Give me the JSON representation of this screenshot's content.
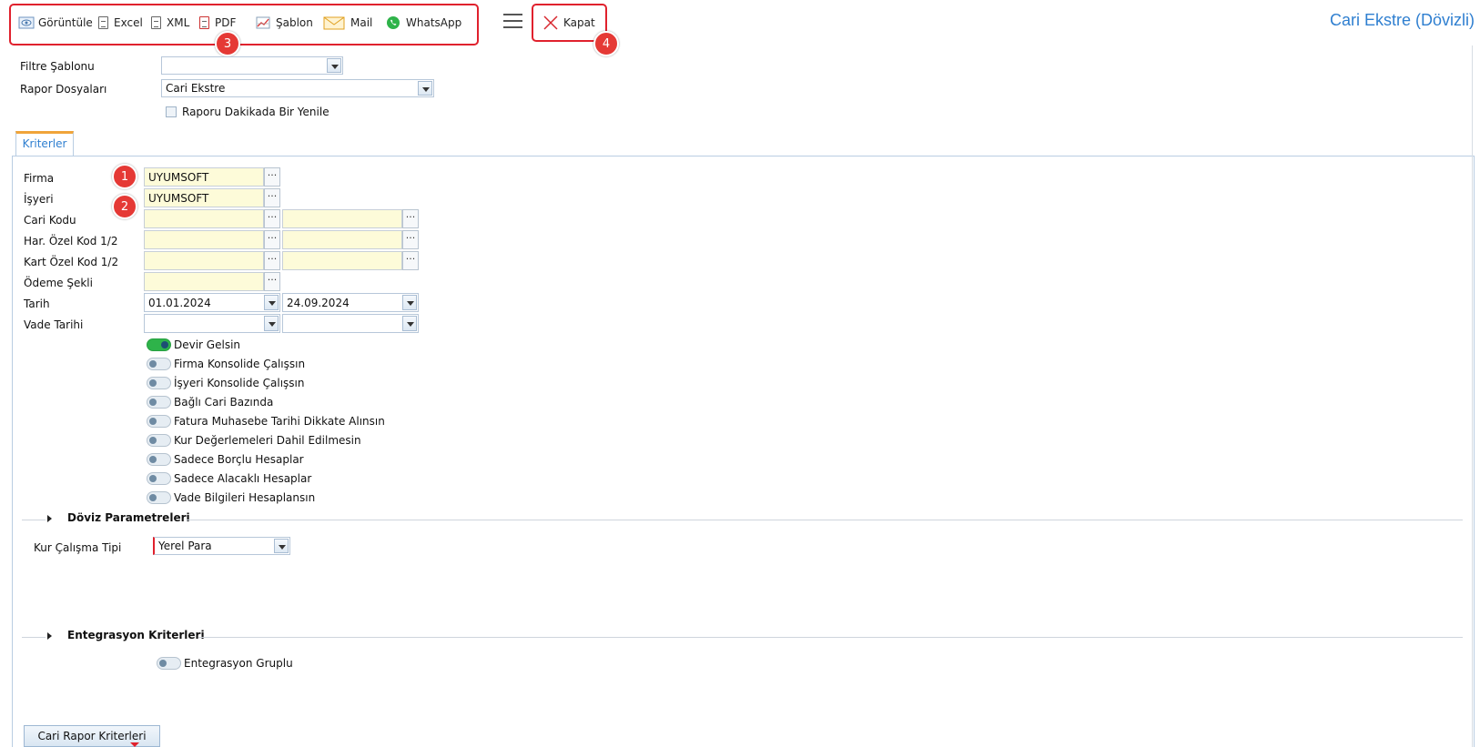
{
  "toolbar": {
    "goruntule": "Görüntüle",
    "excel": "Excel",
    "xml": "XML",
    "pdf": "PDF",
    "sablon": "Şablon",
    "mail": "Mail",
    "whatsapp": "WhatsApp",
    "kapat": "Kapat"
  },
  "page_title": "Cari Ekstre (Dövizli)",
  "badges": {
    "b1": "1",
    "b2": "2",
    "b3": "3",
    "b4": "4"
  },
  "filter": {
    "sablon_label": "Filtre Şablonu",
    "sablon_value": "",
    "rapor_label": "Rapor Dosyaları",
    "rapor_value": "Cari Ekstre",
    "refresh_label": "Raporu Dakikada Bir Yenile"
  },
  "tab": {
    "kriterler": "Kriterler"
  },
  "fields": {
    "firma_label": "Firma",
    "firma_value": "UYUMSOFT",
    "isyeri_label": "İşyeri",
    "isyeri_value": "UYUMSOFT",
    "cari_kodu_label": "Cari Kodu",
    "har_ozel_label": "Har. Özel Kod 1/2",
    "kart_ozel_label": "Kart Özel Kod 1/2",
    "odeme_label": "Ödeme Şekli",
    "tarih_label": "Tarih",
    "tarih_start": "01.01.2024",
    "tarih_end": "24.09.2024",
    "vade_label": "Vade Tarihi",
    "dots": "···"
  },
  "toggles": [
    {
      "label": "Devir Gelsin",
      "on": true
    },
    {
      "label": "Firma Konsolide Çalışsın",
      "on": false
    },
    {
      "label": "İşyeri Konsolide Çalışsın",
      "on": false
    },
    {
      "label": "Bağlı Cari Bazında",
      "on": false
    },
    {
      "label": "Fatura Muhasebe Tarihi Dikkate Alınsın",
      "on": false
    },
    {
      "label": "Kur Değerlemeleri Dahil Edilmesin",
      "on": false
    },
    {
      "label": "Sadece Borçlu Hesaplar",
      "on": false
    },
    {
      "label": "Sadece Alacaklı Hesaplar",
      "on": false
    },
    {
      "label": "Vade Bilgileri Hesaplansın",
      "on": false
    }
  ],
  "doviz": {
    "section_title": "Döviz Parametreleri",
    "kur_label": "Kur Çalışma Tipi",
    "kur_value": "Yerel Para"
  },
  "entegrasyon": {
    "section_title": "Entegrasyon Kriterleri",
    "gruplu_label": "Entegrasyon Gruplu",
    "gruplu_on": false
  },
  "bottom_tab": "Cari Rapor Kriterleri",
  "colors": {
    "accent": "#2f7fd0",
    "highlight": "#e0212d",
    "toggle_on": "#2eb34a",
    "input_yellow": "#fdfbd9"
  }
}
